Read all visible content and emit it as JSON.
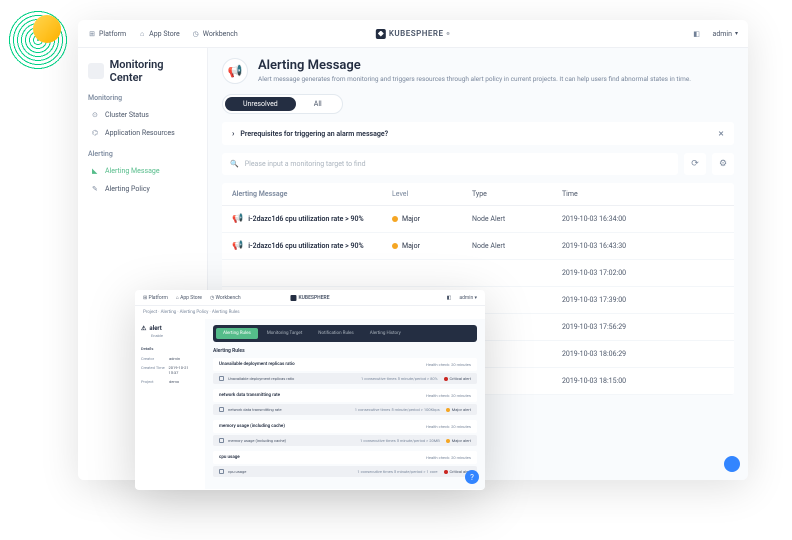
{
  "topbar": {
    "platform": "Platform",
    "appstore": "App Store",
    "workbench": "Workbench",
    "brand": "KUBESPHERE",
    "user": "admin"
  },
  "sidebar": {
    "title": "Monitoring Center",
    "sections": {
      "monitoring": "Monitoring",
      "alerting": "Alerting"
    },
    "items": {
      "cluster": "Cluster Status",
      "appres": "Application Resources",
      "alertmsg": "Alerting Message",
      "alertpol": "Alerting Policy"
    }
  },
  "page": {
    "title": "Alerting Message",
    "desc": "Alert message generates from monitoring and triggers resources through alert policy in current projects. It can help users find abnormal states in time."
  },
  "tabs": {
    "unresolved": "Unresolved",
    "all": "All"
  },
  "prereq": {
    "text": "Prerequisites for triggering an alarm message?"
  },
  "search": {
    "placeholder": "Please input a monitoring target to find"
  },
  "cols": {
    "msg": "Alerting Message",
    "level": "Level",
    "type": "Type",
    "time": "Time"
  },
  "rows": [
    {
      "msg": "i-2dazc1d6 cpu utilization rate > 90%",
      "level": "Major",
      "type": "Node Alert",
      "time": "2019-10-03 16:34:00"
    },
    {
      "msg": "i-2dazc1d6 cpu utilization rate > 90%",
      "level": "Major",
      "type": "Node Alert",
      "time": "2019-10-03 16:43:30"
    },
    {
      "msg": "",
      "level": "",
      "type": "",
      "time": "2019-10-03 17:02:00"
    },
    {
      "msg": "",
      "level": "",
      "type": "",
      "time": "2019-10-03 17:39:00"
    },
    {
      "msg": "",
      "level": "",
      "type": "",
      "time": "2019-10-03 17:56:29"
    },
    {
      "msg": "",
      "level": "",
      "type": "",
      "time": "2019-10-03 18:06:29"
    },
    {
      "msg": "",
      "level": "",
      "type": "",
      "time": "2019-10-03 18:15:00"
    }
  ],
  "overlay": {
    "crumb": "Project · Alerting · Alerting Policy · Alerting Rules",
    "alert_name": "alert",
    "alert_status": "Enable",
    "details_label": "Details",
    "details": [
      {
        "k": "Creator",
        "v": "admin"
      },
      {
        "k": "Created Time",
        "v": "2019-10-21 15:37"
      },
      {
        "k": "Project",
        "v": "demo"
      }
    ],
    "tabs": [
      "Alerting Rules",
      "Monitoring Target",
      "Notification Rules",
      "Alerting History"
    ],
    "section_title": "Alerting Rules",
    "groups": [
      {
        "head": "Unavailable deployment replicas ratio",
        "meta": "Health check: 20 minutes",
        "rule": "Unavailable deployment replicas ratio",
        "cond": "1 consecutive times 5 minute/period > 80%",
        "sev": "Critical alert",
        "sev_class": "ov-sev-crit"
      },
      {
        "head": "network data transmitting rate",
        "meta": "Health check: 20 minutes",
        "rule": "network data transmitting rate",
        "cond": "1 consecutive times 5 minute/period > 100Kbps",
        "sev": "Major alert",
        "sev_class": "ov-sev-maj"
      },
      {
        "head": "memory usage (including cache)",
        "meta": "Health check: 20 minutes",
        "rule": "memory usage (including cache)",
        "cond": "1 consecutive times 5 minute/period > 20MB",
        "sev": "Major alert",
        "sev_class": "ov-sev-maj"
      },
      {
        "head": "cpu usage",
        "meta": "Health check: 20 minutes",
        "rule": "cpu usage",
        "cond": "1 consecutive times 5 minute/period > 1 core",
        "sev": "Critical alert",
        "sev_class": "ov-sev-crit"
      }
    ]
  }
}
